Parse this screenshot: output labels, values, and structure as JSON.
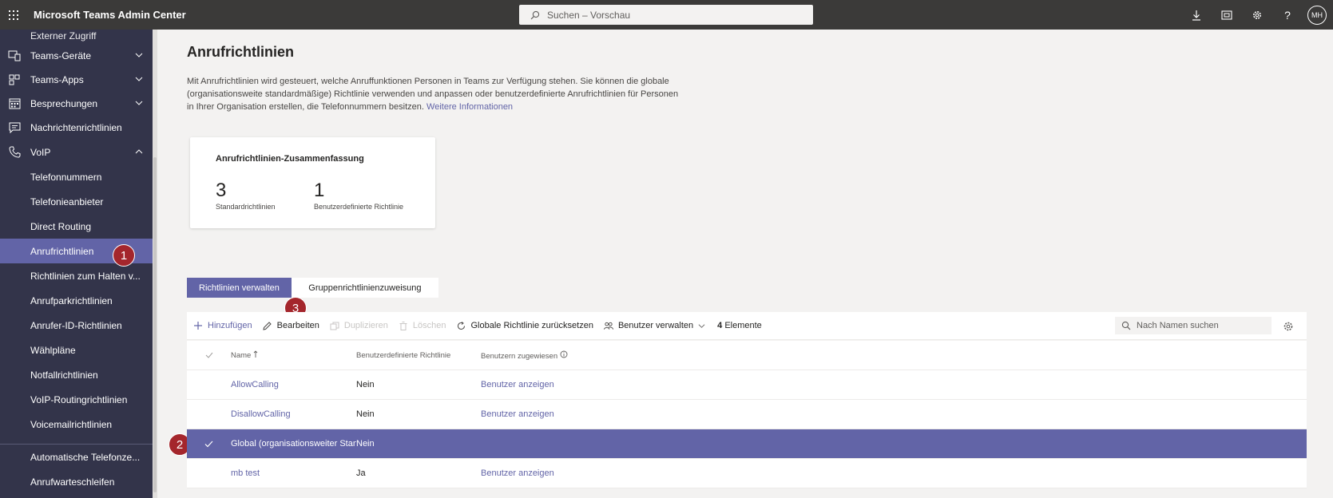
{
  "app": {
    "title": "Microsoft Teams Admin Center",
    "search_placeholder": "Suchen – Vorschau",
    "user_initials": "MH"
  },
  "sidebar": {
    "partial_item": "Externer Zugriff",
    "items": [
      {
        "label": "Teams-Geräte",
        "icon": "devices-icon",
        "expandable": true
      },
      {
        "label": "Teams-Apps",
        "icon": "apps-icon",
        "expandable": true
      },
      {
        "label": "Besprechungen",
        "icon": "calendar-icon",
        "expandable": true
      },
      {
        "label": "Nachrichtenrichtlinien",
        "icon": "chat-icon",
        "expandable": false
      },
      {
        "label": "VoIP",
        "icon": "phone-icon",
        "expanded": true
      }
    ],
    "sub_items": [
      "Telefonnummern",
      "Telefonieanbieter",
      "Direct Routing",
      "Anrufrichtlinien",
      "Richtlinien zum Halten v...",
      "Anrufparkrichtlinien",
      "Anrufer-ID-Richtlinien",
      "Wählpläne",
      "Notfallrichtlinien",
      "VoIP-Routingrichtlinien",
      "Voicemailrichtlinien"
    ],
    "bottom_items": [
      "Automatische Telefonze...",
      "Anrufwarteschleifen"
    ],
    "active_index": 3
  },
  "badges": [
    "1",
    "2",
    "3"
  ],
  "page": {
    "title": "Anrufrichtlinien",
    "description": "Mit Anrufrichtlinien wird gesteuert, welche Anruffunktionen Personen in Teams zur Verfügung stehen. Sie können die globale (organisationsweite standardmäßige) Richtlinie verwenden und anpassen oder benutzerdefinierte Anrufrichtlinien für Personen in Ihrer Organisation erstellen, die Telefonnummern besitzen.",
    "more_info_link": "Weitere Informationen"
  },
  "summary": {
    "title": "Anrufrichtlinien-Zusammenfassung",
    "stats": [
      {
        "value": "3",
        "label": "Standardrichtlinien"
      },
      {
        "value": "1",
        "label": "Benutzerdefinierte Richtlinie"
      }
    ]
  },
  "tabs": [
    {
      "label": "Richtlinien verwalten",
      "active": true
    },
    {
      "label": "Gruppenrichtlinienzuweisung",
      "active": false
    }
  ],
  "toolbar": {
    "add": "Hinzufügen",
    "edit": "Bearbeiten",
    "duplicate": "Duplizieren",
    "delete": "Löschen",
    "reset_global": "Globale Richtlinie zurücksetzen",
    "manage_users": "Benutzer verwalten",
    "count_num": "4",
    "count_label": "Elemente",
    "search_placeholder": "Nach Namen suchen"
  },
  "table": {
    "headers": {
      "name": "Name",
      "custom": "Benutzerdefinierte Richtlinie",
      "assigned": "Benutzern zugewiesen"
    },
    "rows": [
      {
        "name": "AllowCalling",
        "custom": "Nein",
        "assigned": "Benutzer anzeigen",
        "selected": false
      },
      {
        "name": "DisallowCalling",
        "custom": "Nein",
        "assigned": "Benutzer anzeigen",
        "selected": false
      },
      {
        "name": "Global (organisationsweiter Standard)",
        "custom": "Nein",
        "assigned": "",
        "selected": true
      },
      {
        "name": "mb test",
        "custom": "Ja",
        "assigned": "Benutzer anzeigen",
        "selected": false
      }
    ]
  },
  "colors": {
    "accent": "#6264a7",
    "sidebar_bg": "#33344a",
    "topbar_bg": "#3b3a39",
    "badge": "#a4262c"
  }
}
